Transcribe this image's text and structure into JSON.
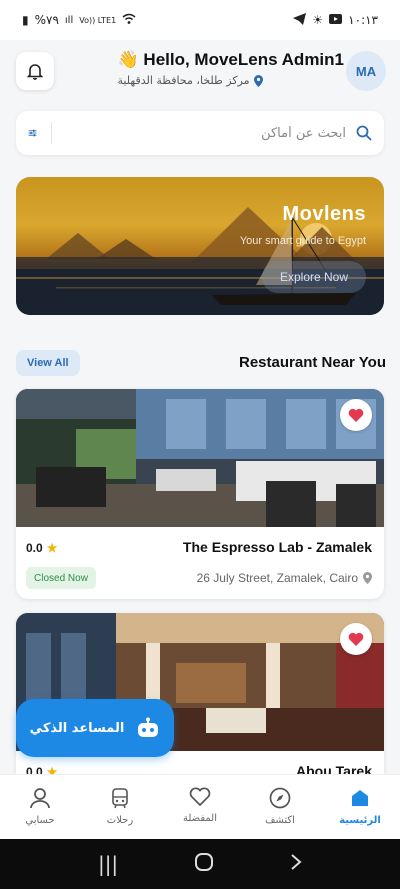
{
  "status_bar": {
    "time": "١٠:١٣",
    "battery": "%٧٩",
    "network": "Vo)) LTE1"
  },
  "header": {
    "greeting": "Hello, MoveLens Admin1",
    "wave": "👋",
    "location": "مركز طلخا، محافظة الدقهلية",
    "avatar_initials": "MA"
  },
  "search": {
    "placeholder": "ابحث عن أماكن"
  },
  "banner": {
    "title": "Movlens",
    "subtitle": "Your smart guide to Egypt",
    "button_label": "Explore Now"
  },
  "section": {
    "title": "Restaurant Near You",
    "view_all": "View All"
  },
  "restaurants": [
    {
      "name": "The Espresso Lab - Zamalek",
      "rating": "0.0",
      "status": "Closed Now",
      "address": "26 July Street, Zamalek, Cairo"
    },
    {
      "name": "Abou Tarek",
      "rating": "0.0"
    }
  ],
  "assistant": {
    "label": "المساعد الذكي"
  },
  "bottom_nav": [
    {
      "label": "الرئيسية",
      "icon": "home-icon",
      "active": true
    },
    {
      "label": "اكتشف",
      "icon": "compass-icon",
      "active": false
    },
    {
      "label": "المفضلة",
      "icon": "heart-icon",
      "active": false
    },
    {
      "label": "رحلات",
      "icon": "bus-icon",
      "active": false
    },
    {
      "label": "حسابي",
      "icon": "person-icon",
      "active": false
    }
  ],
  "colors": {
    "accent": "#1e88e5",
    "favorite": "#e53950",
    "star": "#f4b400",
    "closed_badge_bg": "#e3f4e7",
    "closed_badge_text": "#2e8b48"
  }
}
